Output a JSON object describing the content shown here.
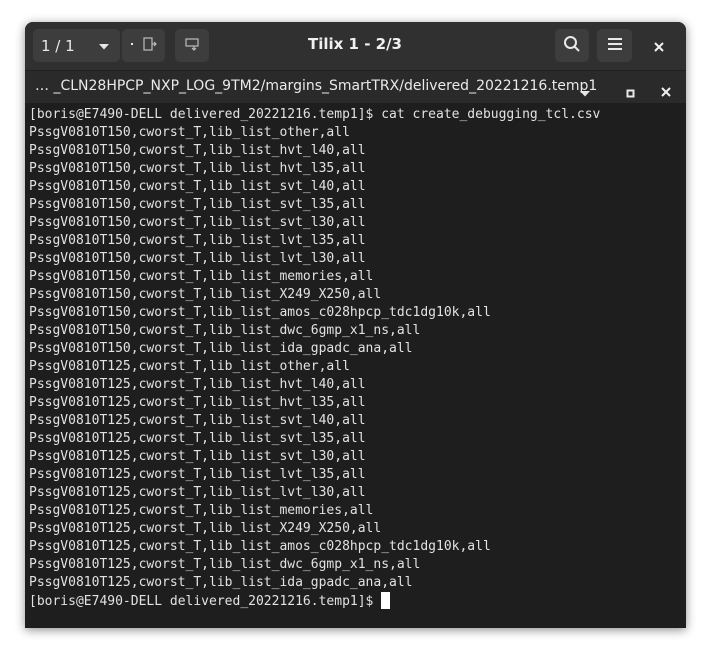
{
  "window": {
    "title": "Tilix 1 - 2/3"
  },
  "headerbar": {
    "session_label": "1 / 1",
    "icons": {
      "session_dropdown": "chevron-down-icon",
      "add_terminal": "plus-icon",
      "split_right": "split-right-icon",
      "split_down": "split-down-icon",
      "search": "search-icon",
      "menu": "hamburger-menu-icon",
      "close": "close-icon"
    }
  },
  "tab": {
    "title": "… _CLN28HPCP_NXP_LOG_9TM2/margins_SmartTRX/delivered_20221216.temp1",
    "icons": {
      "dropdown": "chevron-down-icon",
      "maximize": "maximize-icon",
      "close": "close-icon"
    }
  },
  "terminal": {
    "command_line": "[boris@E7490-DELL delivered_20221216.temp1]$ cat create_debugging_tcl.csv",
    "output_lines": [
      "PssgV0810T150,cworst_T,lib_list_other,all",
      "PssgV0810T150,cworst_T,lib_list_hvt_l40,all",
      "PssgV0810T150,cworst_T,lib_list_hvt_l35,all",
      "PssgV0810T150,cworst_T,lib_list_svt_l40,all",
      "PssgV0810T150,cworst_T,lib_list_svt_l35,all",
      "PssgV0810T150,cworst_T,lib_list_svt_l30,all",
      "PssgV0810T150,cworst_T,lib_list_lvt_l35,all",
      "PssgV0810T150,cworst_T,lib_list_lvt_l30,all",
      "PssgV0810T150,cworst_T,lib_list_memories,all",
      "PssgV0810T150,cworst_T,lib_list_X249_X250,all",
      "PssgV0810T150,cworst_T,lib_list_amos_c028hpcp_tdc1dg10k,all",
      "PssgV0810T150,cworst_T,lib_list_dwc_6gmp_x1_ns,all",
      "PssgV0810T150,cworst_T,lib_list_ida_gpadc_ana,all",
      "PssgV0810T125,cworst_T,lib_list_other,all",
      "PssgV0810T125,cworst_T,lib_list_hvt_l40,all",
      "PssgV0810T125,cworst_T,lib_list_hvt_l35,all",
      "PssgV0810T125,cworst_T,lib_list_svt_l40,all",
      "PssgV0810T125,cworst_T,lib_list_svt_l35,all",
      "PssgV0810T125,cworst_T,lib_list_svt_l30,all",
      "PssgV0810T125,cworst_T,lib_list_lvt_l35,all",
      "PssgV0810T125,cworst_T,lib_list_lvt_l30,all",
      "PssgV0810T125,cworst_T,lib_list_memories,all",
      "PssgV0810T125,cworst_T,lib_list_X249_X250,all",
      "PssgV0810T125,cworst_T,lib_list_amos_c028hpcp_tdc1dg10k,all",
      "PssgV0810T125,cworst_T,lib_list_dwc_6gmp_x1_ns,all",
      "PssgV0810T125,cworst_T,lib_list_ida_gpadc_ana,all"
    ],
    "prompt": "[boris@E7490-DELL delivered_20221216.temp1]$"
  },
  "colors": {
    "headerbar_bg": "#303030",
    "button_bg": "#3d3d3d",
    "tabbar_bg": "#2a2a2a",
    "terminal_bg": "#1e1e1e",
    "terminal_fg": "#e2e2e2",
    "cursor": "#ffffff"
  }
}
